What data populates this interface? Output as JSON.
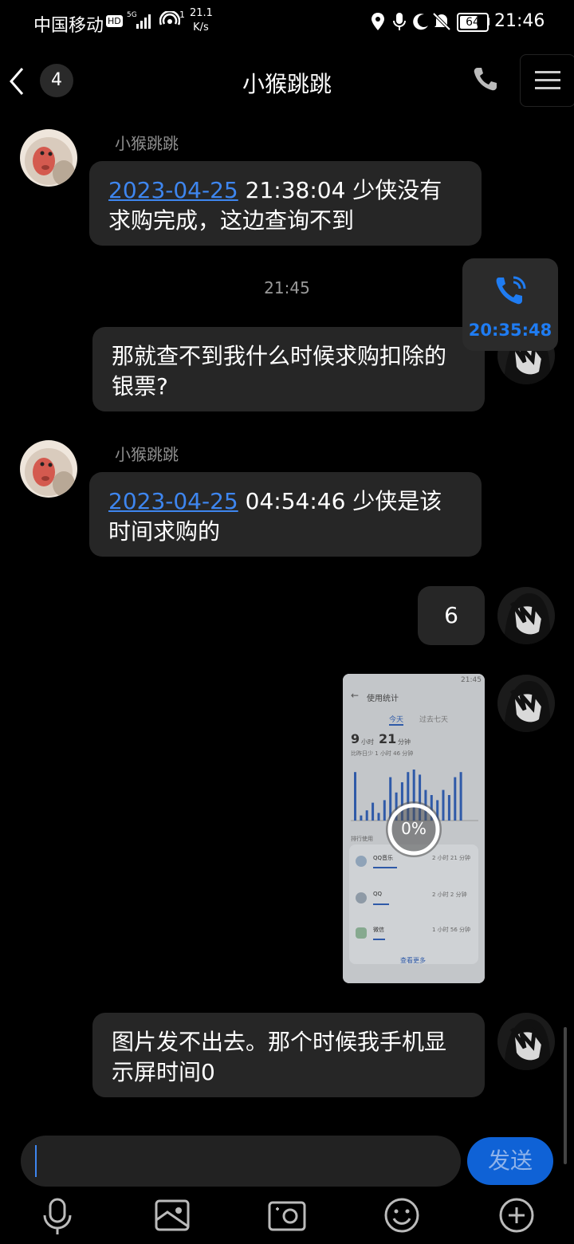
{
  "status_bar": {
    "carrier": "中国移动",
    "hd": "HD",
    "net_type": "5G",
    "wifi_level": "1",
    "speed_value": "21.1",
    "speed_unit": "K/s",
    "battery": "64",
    "time": "21:46"
  },
  "header": {
    "unread_count": "4",
    "title": "小猴跳跳"
  },
  "call_float": {
    "time": "20:35:48"
  },
  "messages": [
    {
      "sender": "小猴跳跳",
      "date": "2023-04-25",
      "text": " 21:38:04 少侠没有求购完成，这边查询不到"
    },
    {
      "separator_time": "21:45"
    },
    {
      "text": "那就查不到我什么时候求购扣除的银票?"
    },
    {
      "sender": "小猴跳跳",
      "date": "2023-04-25",
      "text": " 04:54:46 少侠是该时间求购的"
    },
    {
      "text": "6"
    },
    {
      "image": {
        "status_time": "21:45",
        "title": "使用统计",
        "tab_today": "今天",
        "tab_week": "过去七天",
        "hours": "9",
        "hours_unit": "小时",
        "minutes": "21",
        "minutes_unit": "分钟",
        "compare": "比昨日少 1 小时 46 分钟",
        "section": "排行使用",
        "apps": [
          {
            "name": "QQ音乐",
            "usage": "2 小时 21 分钟",
            "bar": 0.3
          },
          {
            "name": "QQ",
            "usage": "2 小时 2 分钟",
            "bar": 0.2
          },
          {
            "name": "微信",
            "usage": "1 小时 56 分钟",
            "bar": 0.15
          }
        ],
        "more": "查看更多",
        "progress": "0%",
        "chart_bars": [
          0.95,
          0.1,
          0.2,
          0.35,
          0.15,
          0.4,
          0.85,
          0.55,
          0.75,
          0.95,
          1.0,
          0.9,
          0.6,
          0.5,
          0.4,
          0.6,
          0.5,
          0.85,
          0.95
        ]
      }
    },
    {
      "text": "图片发不出去。那个时候我手机显示屏时间0"
    }
  ],
  "input": {
    "value": "",
    "send_label": "发送"
  },
  "toolbar": [
    "voice-icon",
    "image-icon",
    "camera-icon",
    "emoji-icon",
    "plus-icon"
  ]
}
